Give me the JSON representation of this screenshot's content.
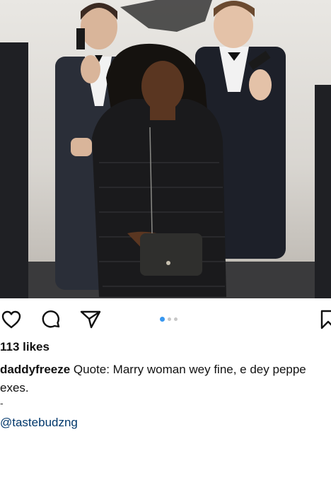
{
  "post": {
    "photo_alt": "",
    "carousel": {
      "count": 3,
      "active": 0
    },
    "actions": {
      "like_icon": "heart-icon",
      "comment_icon": "comment-icon",
      "share_icon": "paper-plane-icon",
      "save_icon": "bookmark-icon"
    },
    "likes": "113 likes",
    "caption": {
      "username": "daddyfreeze",
      "text": " Quote: Marry woman wey fine, e dey peppe",
      "text_line2": "exes.",
      "separator": "-",
      "mention": "@tastebudzng"
    }
  },
  "colors": {
    "accent_dot": "#3897f0",
    "mention": "#00376b"
  }
}
